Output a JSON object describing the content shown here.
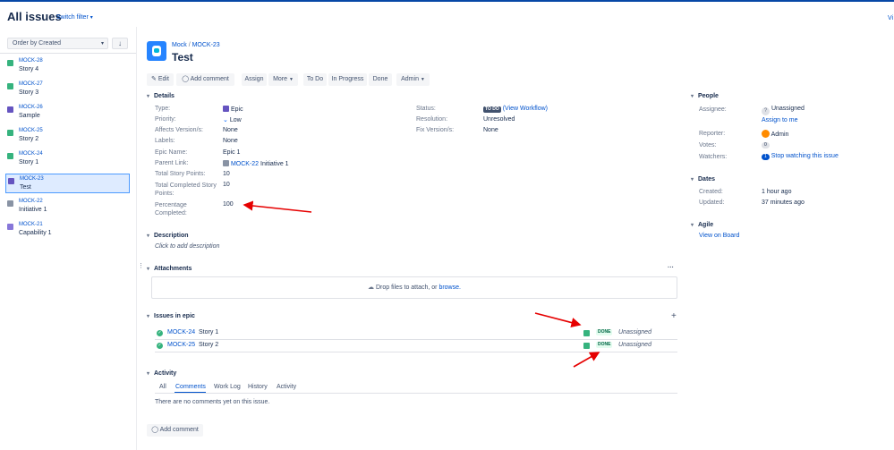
{
  "header": {
    "title": "All issues",
    "switch_filter": "Switch filter",
    "right_clip": "Vi"
  },
  "sidebar": {
    "order_label": "Order by Created",
    "items": [
      {
        "key": "MOCK-28",
        "summary": "Story 4"
      },
      {
        "key": "MOCK-27",
        "summary": "Story 3"
      },
      {
        "key": "MOCK-26",
        "summary": "Sample"
      },
      {
        "key": "MOCK-25",
        "summary": "Story 2"
      },
      {
        "key": "MOCK-24",
        "summary": "Story 1"
      },
      {
        "key": "MOCK-23",
        "summary": "Test"
      },
      {
        "key": "MOCK-22",
        "summary": "Initiative 1"
      },
      {
        "key": "MOCK-21",
        "summary": "Capability 1"
      }
    ]
  },
  "issue": {
    "project": "Mock",
    "key": "MOCK-23",
    "title": "Test"
  },
  "toolbar": {
    "edit": "Edit",
    "add_comment": "Add comment",
    "assign": "Assign",
    "more": "More",
    "todo": "To Do",
    "in_progress": "In Progress",
    "done": "Done",
    "admin": "Admin"
  },
  "details": {
    "heading": "Details",
    "type_label": "Type:",
    "type_value": "Epic",
    "priority_label": "Priority:",
    "priority_value": "Low",
    "affects_label": "Affects Version/s:",
    "affects_value": "None",
    "labels_label": "Labels:",
    "labels_value": "None",
    "epic_name_label": "Epic Name:",
    "epic_name_value": "Epic 1",
    "parent_label": "Parent Link:",
    "parent_key": "MOCK-22",
    "parent_summary": "Initiative 1",
    "tsp_label": "Total Story Points:",
    "tsp_value": "10",
    "tcsp_label_1": "Total Completed Story",
    "tcsp_label_2": "Points:",
    "tcsp_value": "10",
    "pct_label_1": "Percentage",
    "pct_label_2": "Completed:",
    "pct_value": "100",
    "status_label": "Status:",
    "status_lozenge": "TO DO",
    "view_workflow": "(View Workflow)",
    "resolution_label": "Resolution:",
    "resolution_value": "Unresolved",
    "fix_label": "Fix Version/s:",
    "fix_value": "None"
  },
  "description": {
    "heading": "Description",
    "placeholder": "Click to add description"
  },
  "attachments": {
    "heading": "Attachments",
    "more": "···",
    "drop_text": "Drop files to attach, or",
    "browse": "browse."
  },
  "epic_issues": {
    "heading": "Issues in epic",
    "add": "+",
    "rows": [
      {
        "key": "MOCK-24",
        "summary": "Story 1",
        "status": "DONE",
        "assignee": "Unassigned"
      },
      {
        "key": "MOCK-25",
        "summary": "Story 2",
        "status": "DONE",
        "assignee": "Unassigned"
      }
    ]
  },
  "activity": {
    "heading": "Activity",
    "tabs": [
      "All",
      "Comments",
      "Work Log",
      "History",
      "Activity"
    ],
    "empty": "There are no comments yet on this issue.",
    "add_comment": "Add comment"
  },
  "people": {
    "heading": "People",
    "assignee_label": "Assignee:",
    "assignee_value": "Unassigned",
    "assign_to_me": "Assign to me",
    "reporter_label": "Reporter:",
    "reporter_value": "Admin",
    "votes_label": "Votes:",
    "votes_value": "0",
    "watchers_label": "Watchers:",
    "watchers_count": "1",
    "stop_watching": "Stop watching this issue"
  },
  "dates": {
    "heading": "Dates",
    "created_label": "Created:",
    "created_value": "1 hour ago",
    "updated_label": "Updated:",
    "updated_value": "37 minutes ago"
  },
  "agile": {
    "heading": "Agile",
    "view_board": "View on Board"
  },
  "colors": {
    "accent": "#0052cc",
    "done": "#36b37e",
    "annotation": "#e60000"
  }
}
